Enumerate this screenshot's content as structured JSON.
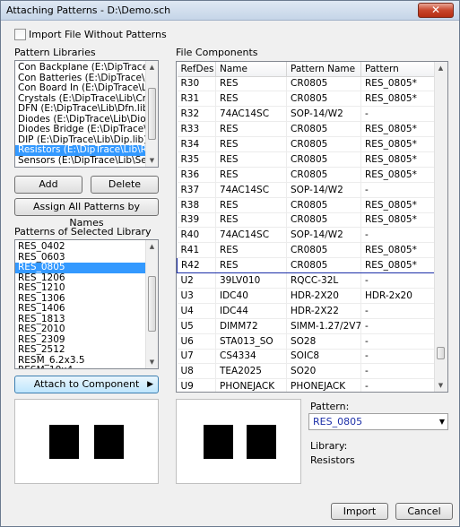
{
  "window": {
    "title": "Attaching Patterns - D:\\Demo.sch",
    "close_glyph": "✕"
  },
  "import_without_patterns": {
    "label": "Import File Without Patterns",
    "checked": false
  },
  "pattern_libraries": {
    "heading": "Pattern Libraries",
    "items": [
      {
        "label": "Con Backplane   (E:\\DipTrace\\Lib\\",
        "selected": false
      },
      {
        "label": "Con Batteries   (E:\\DipTrace\\Lib\\",
        "selected": false
      },
      {
        "label": "Con Board In   (E:\\DipTrace\\Lib\\",
        "selected": false
      },
      {
        "label": "Crystals   (E:\\DipTrace\\Lib\\Crysta",
        "selected": false
      },
      {
        "label": "DFN   (E:\\DipTrace\\Lib\\Dfn.lib)",
        "selected": false
      },
      {
        "label": "Diodes   (E:\\DipTrace\\Lib\\Diodes",
        "selected": false
      },
      {
        "label": "Diodes Bridge   (E:\\DipTrace\\Lib\\",
        "selected": false
      },
      {
        "label": "DIP   (E:\\DipTrace\\Lib\\Dip.lib)",
        "selected": false
      },
      {
        "label": "Resistors   (E:\\DipTrace\\Lib\\Res.",
        "selected": true
      },
      {
        "label": "Sensors   (E:\\DipTrace\\Lib\\Senso",
        "selected": false
      }
    ],
    "add_label": "Add",
    "delete_label": "Delete",
    "assign_label": "Assign All Patterns by Names"
  },
  "patterns_of_library": {
    "heading": "Patterns of Selected Library",
    "items": [
      {
        "label": "RES_0402",
        "selected": false
      },
      {
        "label": "RES_0603",
        "selected": false
      },
      {
        "label": "RES_0805",
        "selected": true
      },
      {
        "label": "RES_1206",
        "selected": false
      },
      {
        "label": "RES_1210",
        "selected": false
      },
      {
        "label": "RES_1306",
        "selected": false
      },
      {
        "label": "RES_1406",
        "selected": false
      },
      {
        "label": "RES_1813",
        "selected": false
      },
      {
        "label": "RES_2010",
        "selected": false
      },
      {
        "label": "RES_2309",
        "selected": false
      },
      {
        "label": "RES_2512",
        "selected": false
      },
      {
        "label": "RESM_6.2x3.5",
        "selected": false
      },
      {
        "label": "RESM_10x4",
        "selected": false
      }
    ],
    "attach_label": "Attach to Component",
    "attach_glyph": "▶"
  },
  "file_components": {
    "heading": "File Components",
    "columns": [
      "RefDes",
      "Name",
      "Pattern Name",
      "Pattern"
    ],
    "rows": [
      {
        "refdes": "R30",
        "name": "RES",
        "pattern_name": "CR0805",
        "pattern": "RES_0805*"
      },
      {
        "refdes": "R31",
        "name": "RES",
        "pattern_name": "CR0805",
        "pattern": "RES_0805*"
      },
      {
        "refdes": "R32",
        "name": "74AC14SC",
        "pattern_name": "SOP-14/W2",
        "pattern": "-"
      },
      {
        "refdes": "R33",
        "name": "RES",
        "pattern_name": "CR0805",
        "pattern": "RES_0805*"
      },
      {
        "refdes": "R34",
        "name": "RES",
        "pattern_name": "CR0805",
        "pattern": "RES_0805*"
      },
      {
        "refdes": "R35",
        "name": "RES",
        "pattern_name": "CR0805",
        "pattern": "RES_0805*"
      },
      {
        "refdes": "R36",
        "name": "RES",
        "pattern_name": "CR0805",
        "pattern": "RES_0805*"
      },
      {
        "refdes": "R37",
        "name": "74AC14SC",
        "pattern_name": "SOP-14/W2",
        "pattern": "-"
      },
      {
        "refdes": "R38",
        "name": "RES",
        "pattern_name": "CR0805",
        "pattern": "RES_0805*"
      },
      {
        "refdes": "R39",
        "name": "RES",
        "pattern_name": "CR0805",
        "pattern": "RES_0805*"
      },
      {
        "refdes": "R40",
        "name": "74AC14SC",
        "pattern_name": "SOP-14/W2",
        "pattern": "-"
      },
      {
        "refdes": "R41",
        "name": "RES",
        "pattern_name": "CR0805",
        "pattern": "RES_0805*"
      },
      {
        "refdes": "R42",
        "name": "RES",
        "pattern_name": "CR0805",
        "pattern": "RES_0805*",
        "selected": true
      },
      {
        "refdes": "U2",
        "name": "39LV010",
        "pattern_name": "RQCC-32L",
        "pattern": "-"
      },
      {
        "refdes": "U3",
        "name": "IDC40",
        "pattern_name": "HDR-2X20",
        "pattern": "HDR-2x20"
      },
      {
        "refdes": "U4",
        "name": "IDC44",
        "pattern_name": "HDR-2X22",
        "pattern": "-"
      },
      {
        "refdes": "U5",
        "name": "DIMM72",
        "pattern_name": "SIMM-1.27/2V72",
        "pattern": "-"
      },
      {
        "refdes": "U6",
        "name": "STA013_SO",
        "pattern_name": "SO28",
        "pattern": "-"
      },
      {
        "refdes": "U7",
        "name": "CS4334",
        "pattern_name": "SOIC8",
        "pattern": "-"
      },
      {
        "refdes": "U8",
        "name": "TEA2025",
        "pattern_name": "SO20",
        "pattern": "-"
      },
      {
        "refdes": "U9",
        "name": "PHONEJACK",
        "pattern_name": "PHONEJACK",
        "pattern": "-"
      }
    ]
  },
  "pattern_select": {
    "label": "Pattern:",
    "value": "RES_0805"
  },
  "library_info": {
    "label": "Library:",
    "value": "Resistors"
  },
  "footer": {
    "import_label": "Import",
    "cancel_label": "Cancel"
  },
  "colors": {
    "selection": "#3399ff",
    "row_highlight_border": "#1c2fa8",
    "titlebar": "#c5d5e8",
    "close_button": "#c8452b"
  }
}
